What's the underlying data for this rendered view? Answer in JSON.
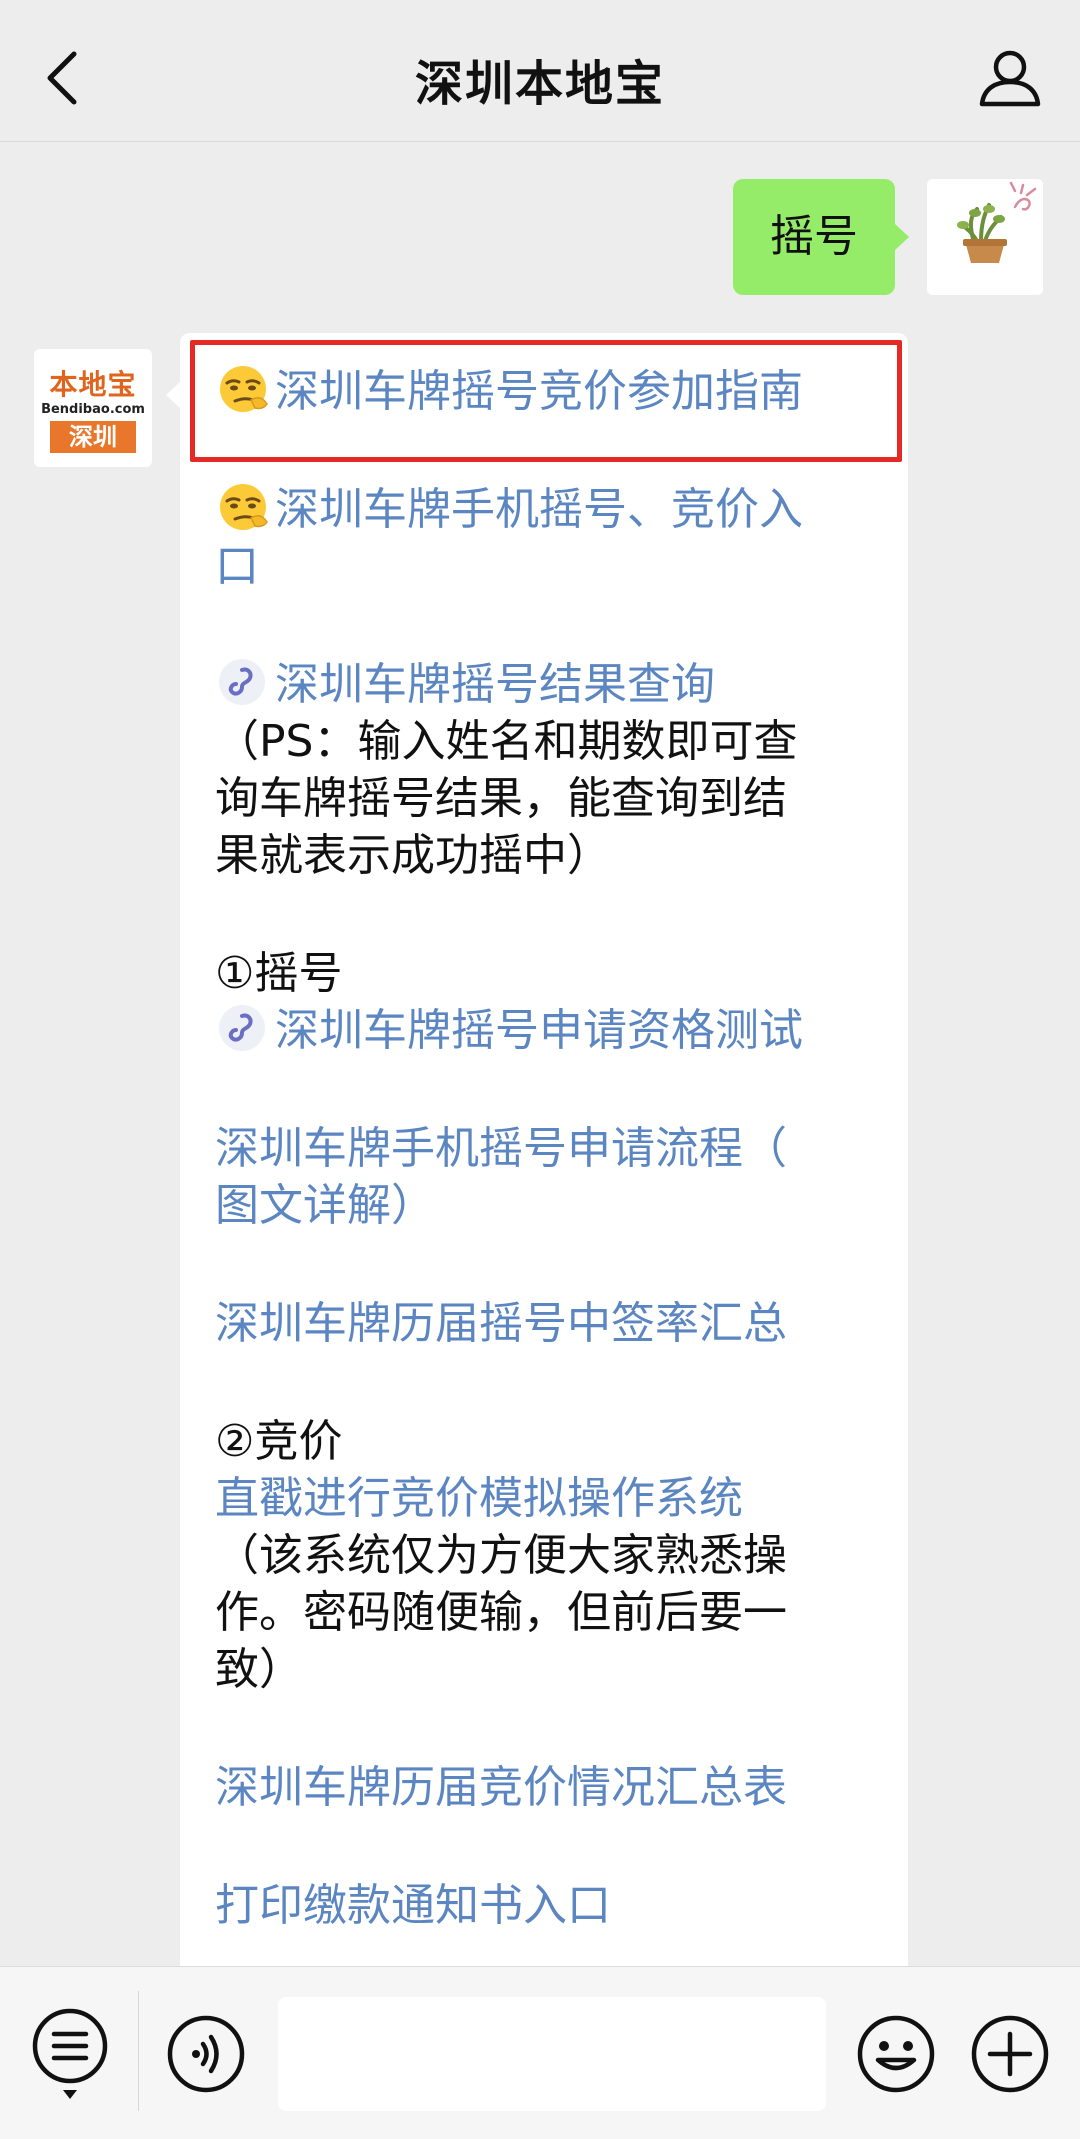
{
  "header": {
    "title": "深圳本地宝"
  },
  "outgoing": {
    "text": "摇号"
  },
  "account_logo": {
    "top_text": "本地宝",
    "domain_text": "Bendibao.com",
    "city_text": "深圳"
  },
  "incoming": {
    "items": [
      "深圳车牌摇号竞价参加指南",
      "深圳车牌手机摇号、竞价入",
      "口",
      "深圳车牌摇号结果查询",
      "（PS：输入姓名和期数即可查",
      "询车牌摇号结果，能查询到结",
      "果就表示成功摇中）",
      "①摇号",
      "深圳车牌摇号申请资格测试",
      "深圳车牌手机摇号申请流程（",
      "图文详解）",
      "深圳车牌历届摇号中签率汇总",
      "②竞价",
      "直戳进行竞价模拟操作系统",
      "（该系统仅为方便大家熟悉操",
      "作。密码随便输，但前后要一",
      "致）",
      "深圳车牌历届竞价情况汇总表",
      "打印缴款通知书入口"
    ]
  },
  "colors": {
    "link": "#5b86c1",
    "bubble_green": "#95ec69",
    "highlight": "#e52a26",
    "background": "#ededed"
  },
  "icons": {
    "back": "chevron-left-icon",
    "profile": "person-icon",
    "menu": "list-menu-icon",
    "voice": "voice-icon",
    "emoji": "smiley-icon",
    "plus": "plus-circle-icon",
    "inline_emoji": "smirk-emoji-icon",
    "mini_program": "mini-program-link-icon"
  }
}
